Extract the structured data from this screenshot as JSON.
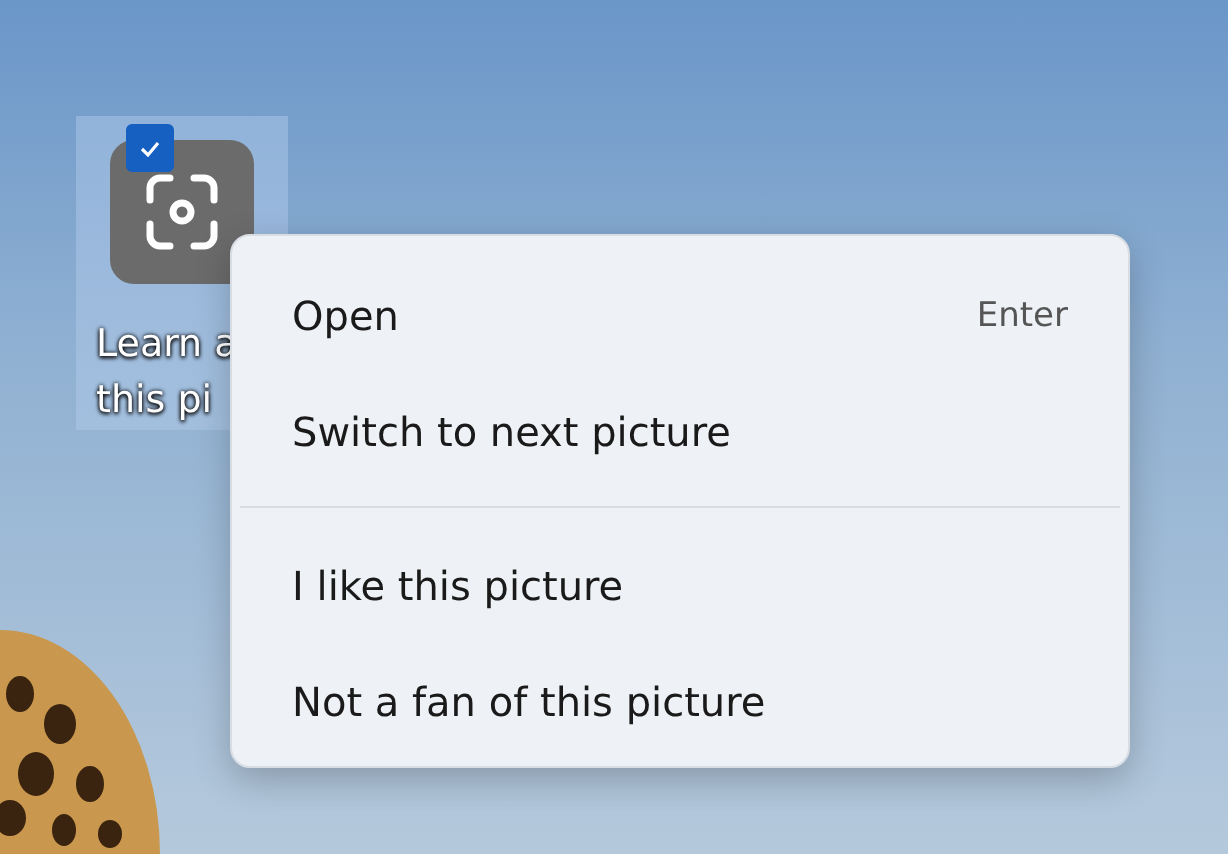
{
  "desktop_icon": {
    "label_lines": [
      "Learn a",
      "this pi"
    ],
    "selected": true,
    "checked": true
  },
  "context_menu": {
    "sections": [
      {
        "items": [
          {
            "label": "Open",
            "shortcut": "Enter"
          },
          {
            "label": "Switch to next picture"
          }
        ]
      },
      {
        "items": [
          {
            "label": "I like this picture"
          },
          {
            "label": "Not a fan of this picture"
          }
        ]
      }
    ]
  }
}
